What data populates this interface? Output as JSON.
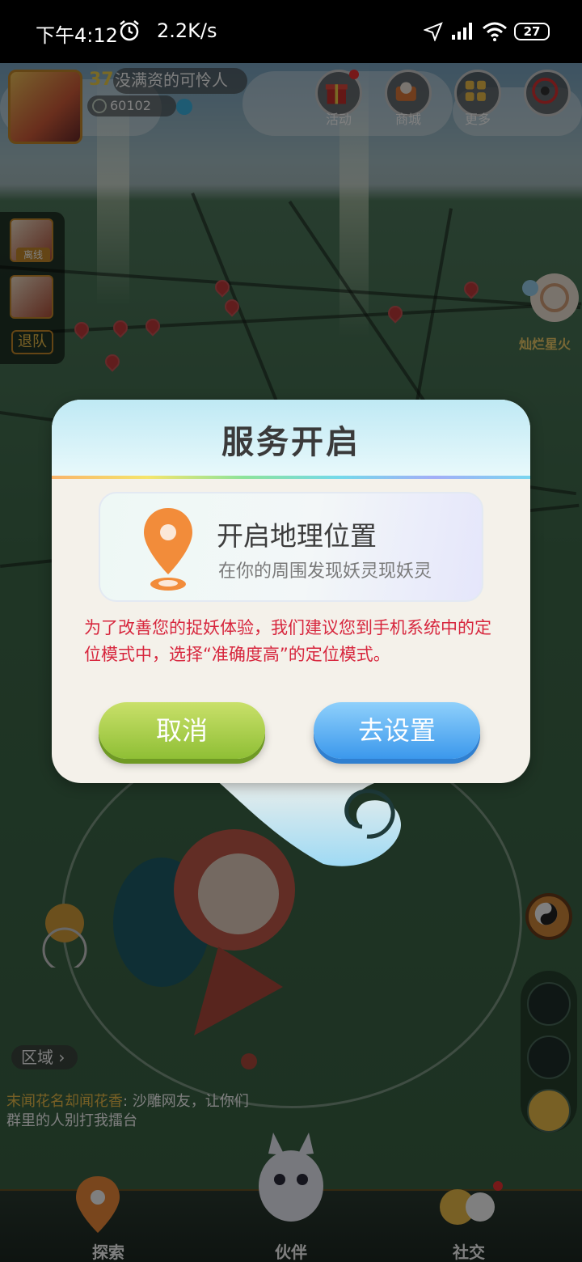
{
  "status_bar": {
    "time": "下午4:12",
    "net_speed": "2.2K/s",
    "battery": "27"
  },
  "hud": {
    "level": "37",
    "player_name": "没满资的可怜人",
    "coins": "60102",
    "buttons": [
      {
        "label": "活动",
        "icon": "gift-icon"
      },
      {
        "label": "商城",
        "icon": "shop-icon"
      },
      {
        "label": "更多",
        "icon": "grid-icon"
      }
    ]
  },
  "team_panel": {
    "offline_label": "离线",
    "leave_label": "退队"
  },
  "map": {
    "spirit_name": "灿烂星火",
    "region_label": "区域",
    "chat": {
      "name": "末闻花名却闻花香",
      "message": ": 沙雕网友，让你们群里的人别打我擂台"
    }
  },
  "bottom_nav": {
    "items": [
      "探索",
      "伙伴",
      "社交"
    ]
  },
  "dialog": {
    "title": "服务开启",
    "card_title": "开启地理位置",
    "card_subtitle": "在你的周围发现妖灵现妖灵",
    "notice": "为了改善您的捉妖体验，我们建议您到手机系统中的定位模式中，选择“准确度高”的定位模式。",
    "cancel_label": "取消",
    "settings_label": "去设置"
  },
  "colors": {
    "notice_text": "#d7263d",
    "cancel_button": "#a3cc48",
    "settings_button": "#5aaaf0",
    "pin_orange": "#f28c3a"
  }
}
